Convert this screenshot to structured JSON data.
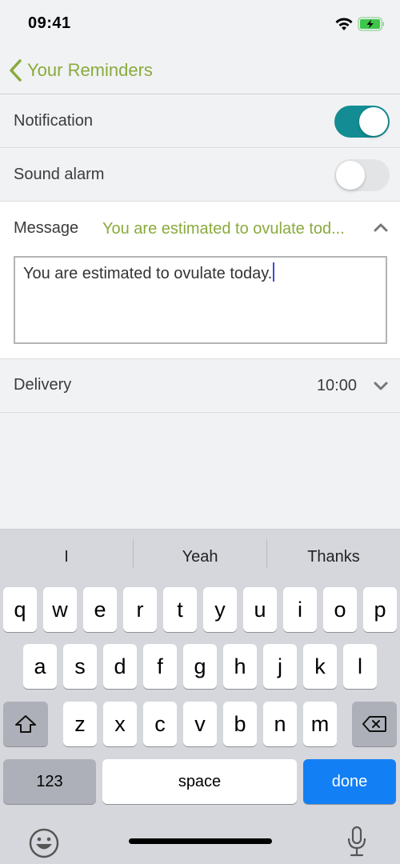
{
  "status_bar": {
    "time": "09:41",
    "icons": [
      "wifi-icon",
      "battery-charging-icon"
    ],
    "battery_color": "#3ec64a"
  },
  "nav": {
    "back_label": "Your Reminders",
    "back_icon": "chevron-left-icon",
    "accent_color": "#8aaa3c"
  },
  "settings": {
    "notification": {
      "label": "Notification",
      "on": true
    },
    "sound_alarm": {
      "label": "Sound alarm",
      "on": false
    },
    "toggle_on_color": "#138d93",
    "message": {
      "label": "Message",
      "preview": "You are estimated to ovulate tod...",
      "value": "You are estimated to ovulate today.",
      "expanded": true
    },
    "delivery": {
      "label": "Delivery",
      "value": "10:00",
      "expanded": false
    }
  },
  "keyboard": {
    "suggestions": [
      "I",
      "Yeah",
      "Thanks"
    ],
    "row1": [
      "q",
      "w",
      "e",
      "r",
      "t",
      "y",
      "u",
      "i",
      "o",
      "p"
    ],
    "row2": [
      "a",
      "s",
      "d",
      "f",
      "g",
      "h",
      "j",
      "k",
      "l"
    ],
    "row3": [
      "z",
      "x",
      "c",
      "v",
      "b",
      "n",
      "m"
    ],
    "shift_icon": "shift-icon",
    "delete_icon": "backspace-icon",
    "numbers_label": "123",
    "space_label": "space",
    "done_label": "done",
    "done_color": "#137ff5",
    "emoji_icon": "emoji-icon",
    "mic_icon": "microphone-icon"
  }
}
